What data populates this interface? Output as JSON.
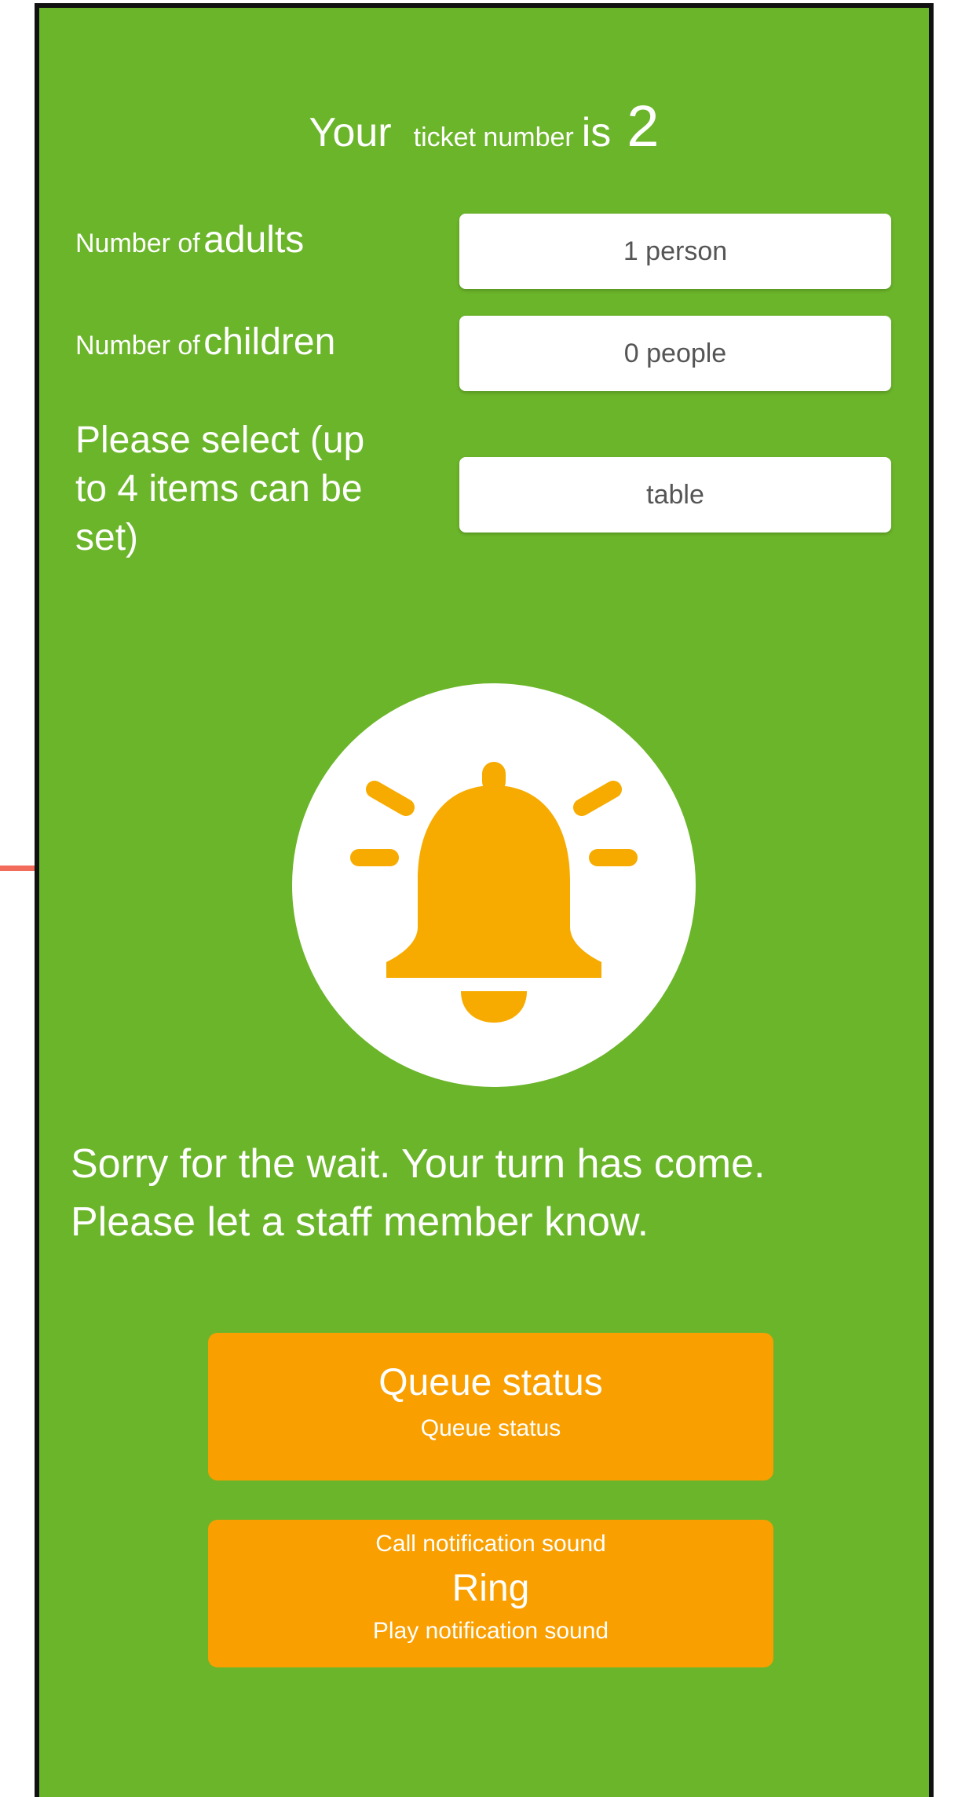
{
  "ticket": {
    "your": "Your",
    "ticket_number_label": "ticket number",
    "is": "is",
    "number": "2"
  },
  "form": {
    "adults": {
      "label_small": "Number of",
      "label_big": "adults",
      "value": "1 person"
    },
    "children": {
      "label_small": "Number of",
      "label_big": "children",
      "value": "0 people"
    },
    "select": {
      "label": "Please select (up\nto 4 items can be\nset)",
      "value": "table"
    }
  },
  "bell": {
    "icon": "bell-ringing-icon",
    "color": "#f7ab00"
  },
  "message": {
    "line1": "Sorry for the wait. Your turn has come.",
    "line2": "Please let a staff member know."
  },
  "buttons": {
    "queue": {
      "main": "Queue status",
      "sub": "Queue status"
    },
    "ring": {
      "top": "Call notification sound",
      "main": "Ring",
      "sub": "Play notification sound"
    }
  },
  "colors": {
    "background": "#6bb52a",
    "button": "#f99f00",
    "accent_line": "#f26b5b"
  }
}
